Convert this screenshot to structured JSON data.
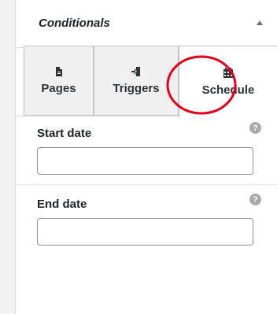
{
  "panel": {
    "title": "Conditionals"
  },
  "tabs": [
    {
      "label": "Pages",
      "icon": "document-icon",
      "active": false
    },
    {
      "label": "Triggers",
      "icon": "login-arrow-icon",
      "active": false
    },
    {
      "label": "Schedule",
      "icon": "calendar-icon",
      "active": true
    }
  ],
  "fields": {
    "start": {
      "label": "Start date",
      "value": "",
      "help": "?"
    },
    "end": {
      "label": "End date",
      "value": "",
      "help": "?"
    }
  },
  "colors": {
    "annotation": "#e5001c",
    "tab_inactive_bg": "#f0f0f1",
    "help_icon": "#a7aaad"
  }
}
